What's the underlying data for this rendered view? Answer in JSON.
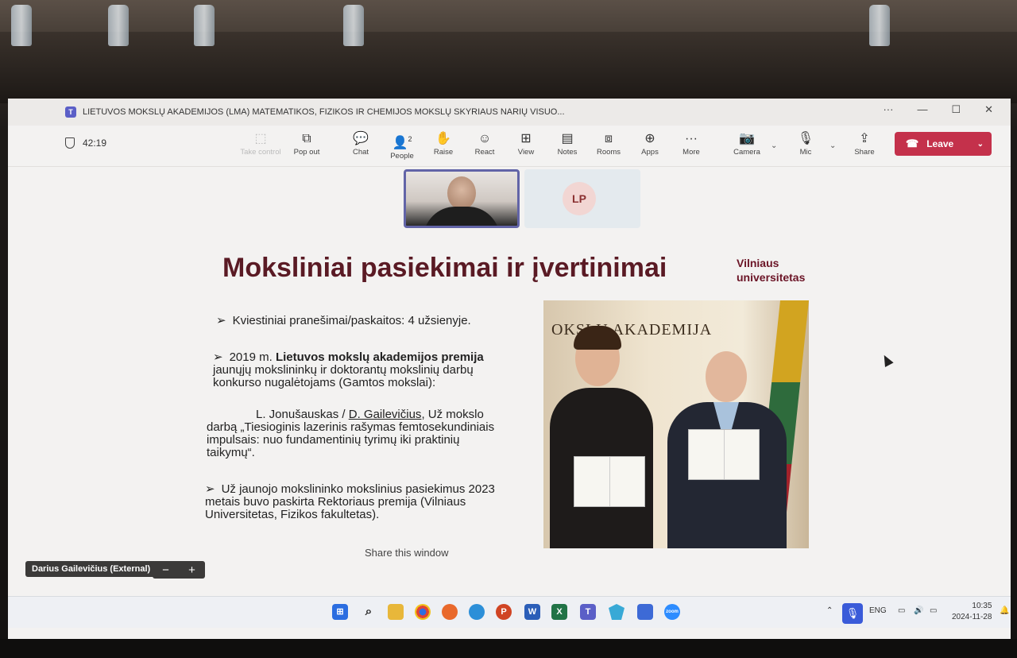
{
  "window": {
    "title": "LIETUVOS MOKSLŲ AKADEMIJOS (LMA) MATEMATIKOS, FIZIKOS IR CHEMIJOS MOKSLŲ SKYRIAUS NARIŲ VISUO...",
    "more": "···",
    "minimize": "—",
    "maximize": "☐",
    "close": "✕"
  },
  "toolbar": {
    "timer": "42:19",
    "take_control": "Take control",
    "pop_out": "Pop out",
    "chat": "Chat",
    "people": "People",
    "people_count": "2",
    "raise": "Raise",
    "react": "React",
    "view": "View",
    "notes": "Notes",
    "rooms": "Rooms",
    "apps": "Apps",
    "more": "More",
    "camera": "Camera",
    "mic": "Mic",
    "share": "Share",
    "leave": "Leave"
  },
  "participants": {
    "lp_initials": "LP"
  },
  "slide": {
    "title": "Moksliniai pasiekimai ir įvertinimai",
    "logo_line1": "Vilniaus",
    "logo_line2": "universitetas",
    "bullet1": "Kviestiniai pranešimai/paskaitos: 4 užsienyje.",
    "bullet2_pre": "2019 m. ",
    "bullet2_bold": "Lietuvos mokslų akademijos premija",
    "bullet2_post": " jaunųjų mokslininkų ir doktorantų mokslinių darbų konkurso nugalėtojams (Gamtos mokslai):",
    "bullet3_pre": "L. Jonušauskas / ",
    "bullet3_under": "D. Gailevičius",
    "bullet3_post": ", Už mokslo darbą „Tiesioginis lazerinis rašymas femtosekundiniais impulsais: nuo fundamentinių tyrimų iki praktinių taikymų“.",
    "bullet4": "Už jaunojo mokslininko mokslinius pasiekimus 2023 metais buvo paskirta Rektoriaus premija (Vilniaus Universitetas, Fizikos fakultetas).",
    "photo_sign": "OKSLŲ AKADEMIJA",
    "share_label": "Share this window"
  },
  "presenter": {
    "name": "Darius Gailevičius (External)",
    "zoom_out": "−",
    "zoom_in": "+"
  },
  "taskbar": {
    "lang": "ENG",
    "time": "10:35",
    "date": "2024-11-28",
    "zoom_label": "zoom"
  }
}
